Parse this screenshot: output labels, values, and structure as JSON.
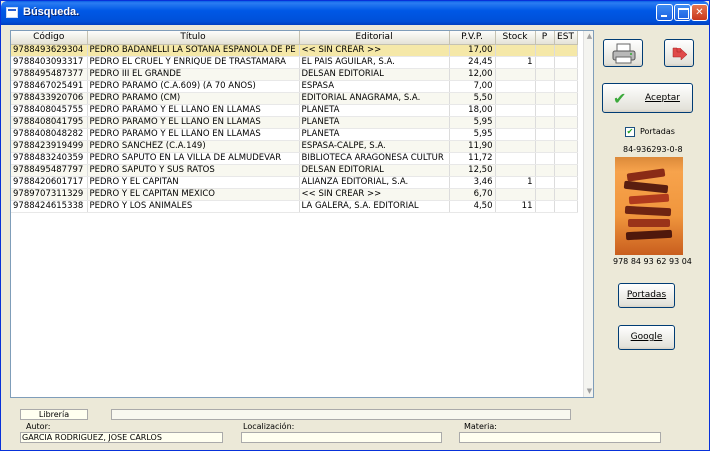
{
  "window": {
    "title": "Búsqueda."
  },
  "table": {
    "columns": [
      "Código",
      "Título",
      "Editorial",
      "P.V.P.",
      "Stock",
      "P",
      "EST"
    ],
    "rows": [
      [
        "9788493629304",
        "PEDRO BADANELLI LA SOTANA ESPAÑOLA DE PE",
        "<< SIN CREAR >>",
        "17,00",
        "",
        "",
        ""
      ],
      [
        "9788403093317",
        "PEDRO EL CRUEL Y ENRIQUE DE TRASTAMARA",
        "EL PAIS AGUILAR, S.A.",
        "24,45",
        "1",
        "",
        ""
      ],
      [
        "9788495487377",
        "PEDRO III EL GRANDE",
        "DELSAN EDITORIAL",
        "12,00",
        "",
        "",
        ""
      ],
      [
        "9788467025491",
        "PEDRO PARAMO (C.A.609) (A 70 AÑOS)",
        "ESPASA",
        "7,00",
        "",
        "",
        ""
      ],
      [
        "9788433920706",
        "PEDRO PARAMO (CM)",
        "EDITORIAL ANAGRAMA, S.A.",
        "5,50",
        "",
        "",
        ""
      ],
      [
        "9788408045755",
        "PEDRO PARAMO Y EL LLANO EN LLAMAS",
        "PLANETA",
        "18,00",
        "",
        "",
        ""
      ],
      [
        "9788408041795",
        "PEDRO PARAMO Y EL LLANO EN LLAMAS",
        "PLANETA",
        "5,95",
        "",
        "",
        ""
      ],
      [
        "9788408048282",
        "PEDRO PARAMO Y EL LLANO EN LLAMAS",
        "PLANETA",
        "5,95",
        "",
        "",
        ""
      ],
      [
        "9788423919499",
        "PEDRO SANCHEZ (C.A.149)",
        "ESPASA-CALPE, S.A.",
        "11,90",
        "",
        "",
        ""
      ],
      [
        "9788483240359",
        "PEDRO SAPUTO EN LA VILLA DE ALMUDEVAR",
        "BIBLIOTECA ARAGONESA CULTUR",
        "11,72",
        "",
        "",
        ""
      ],
      [
        "9788495487797",
        "PEDRO SAPUTO Y SUS RATOS",
        "DELSAN EDITORIAL",
        "12,50",
        "",
        "",
        ""
      ],
      [
        "9788420601717",
        "PEDRO Y EL CAPITAN",
        "ALIANZA EDITORIAL, S.A.",
        "3,46",
        "1",
        "",
        ""
      ],
      [
        "9789707311329",
        "PEDRO Y EL CAPITAN   MEXICO",
        "<< SIN CREAR >>",
        "6,70",
        "",
        "",
        ""
      ],
      [
        "9788424615338",
        "PEDRO Y LOS ANIMALES",
        "LA GALERA, S.A. EDITORIAL",
        "4,50",
        "11",
        "",
        ""
      ]
    ]
  },
  "side": {
    "accept_label": "Aceptar",
    "portadas_check_label": "Portadas",
    "portadas_checked": true,
    "isbn_top": "84-936293-0-8",
    "isbn_bottom": "978 84 93 62 93 04",
    "portadas_button": "Portadas",
    "google_button": "Google"
  },
  "footer": {
    "tab_label": "Librería",
    "autor_label": "Autor:",
    "autor_value": "GARCIA RODRIGUEZ, JOSE CARLOS",
    "localizacion_label": "Localización:",
    "localizacion_value": "",
    "materia_label": "Materia:",
    "materia_value": ""
  },
  "icons": {
    "printer": "printer-icon",
    "exit": "exit-arrow-icon",
    "accept": "checkmark-icon"
  },
  "colors": {
    "selected_row": "#f5e8a8",
    "titlebar": "#0058e6"
  }
}
